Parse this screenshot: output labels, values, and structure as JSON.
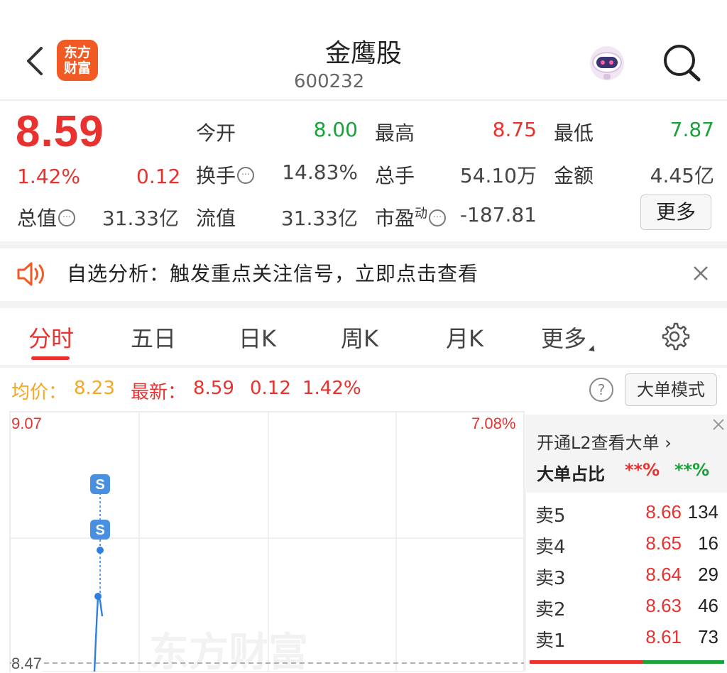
{
  "header": {
    "stock_name": "金鹰股",
    "stock_code": "600232",
    "logo_text_line1": "东方",
    "logo_text_line2": "财富"
  },
  "quote": {
    "price": "8.59",
    "change_pct": "1.42%",
    "change_abs": "0.12",
    "fields": {
      "open_label": "今开",
      "open_value": "8.00",
      "high_label": "最高",
      "high_value": "8.75",
      "low_label": "最低",
      "low_value": "7.87",
      "turnover_label": "换手",
      "turnover_value": "14.83%",
      "volume_label": "总手",
      "volume_value": "54.10万",
      "amount_label": "金额",
      "amount_value": "4.45亿",
      "mktcap_label": "总值",
      "mktcap_value": "31.33亿",
      "float_label": "流值",
      "float_value": "31.33亿",
      "pe_label": "市盈",
      "pe_sup": "动",
      "pe_value": "-187.81"
    },
    "more_button": "更多"
  },
  "notice": {
    "text": "自选分析：触发重点关注信号，立即点击查看"
  },
  "tabs": [
    {
      "label": "分时",
      "active": true
    },
    {
      "label": "五日",
      "active": false
    },
    {
      "label": "日K",
      "active": false
    },
    {
      "label": "周K",
      "active": false
    },
    {
      "label": "月K",
      "active": false
    },
    {
      "label": "更多",
      "active": false
    }
  ],
  "info_row": {
    "avg_label": "均价：",
    "avg_value": "8.23",
    "latest_label": "最新：",
    "latest_value": "8.59",
    "latest_change": "0.12",
    "latest_pct": "1.42%",
    "mode_button": "大单模式"
  },
  "chart": {
    "y_top": "9.07",
    "y_top_pct": "7.08%",
    "y_ref": "8.47",
    "marker_label": "S",
    "watermark": "东方财富"
  },
  "order_book": {
    "l2_text": "开通L2查看大单 ›",
    "ratio_label": "大单占比",
    "ratio_red": "**%",
    "ratio_green": "**%",
    "rows": [
      {
        "label": "卖5",
        "price": "8.66",
        "volume": "134"
      },
      {
        "label": "卖4",
        "price": "8.65",
        "volume": "16"
      },
      {
        "label": "卖3",
        "price": "8.64",
        "volume": "29"
      },
      {
        "label": "卖2",
        "price": "8.63",
        "volume": "46"
      },
      {
        "label": "卖1",
        "price": "8.61",
        "volume": "73"
      }
    ]
  },
  "colors": {
    "up": "#e8322f",
    "down": "#1aa23a",
    "accent": "#e8322f",
    "avg_line": "#f5a623",
    "price_line": "#2f7fe0"
  }
}
